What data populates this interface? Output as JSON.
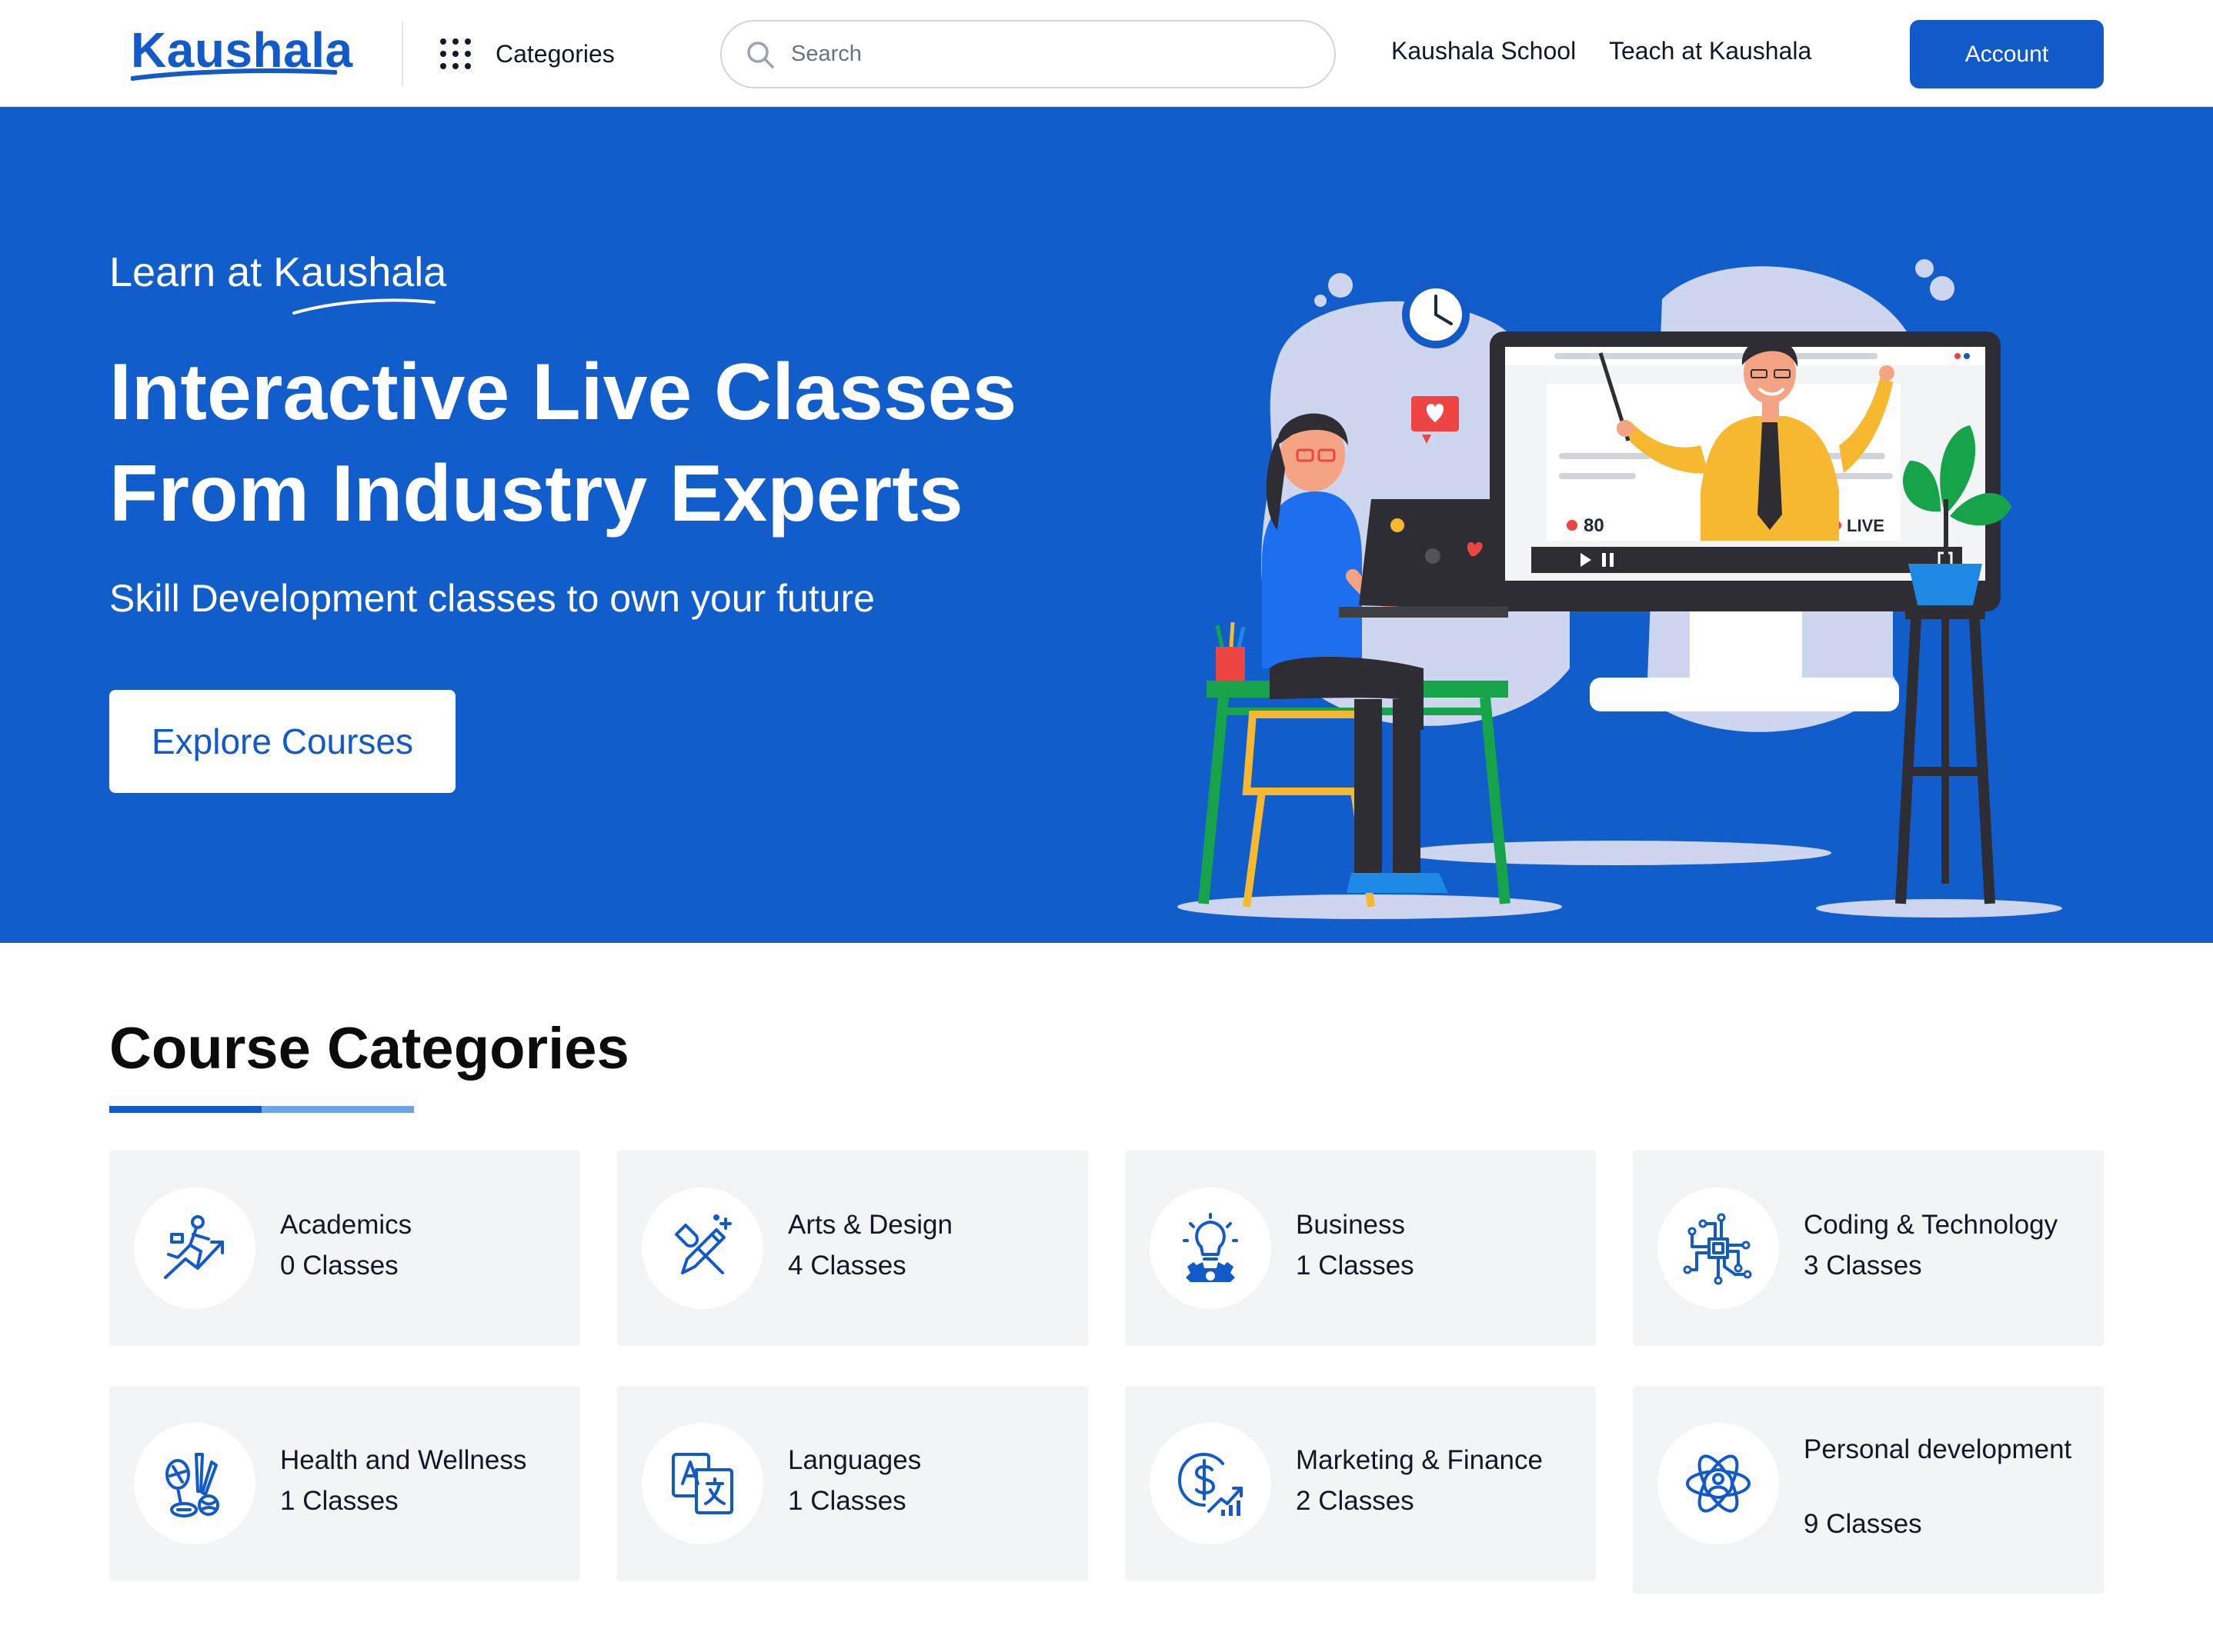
{
  "brand": {
    "name": "Kaushala",
    "color": "#1259c9"
  },
  "header": {
    "categories_label": "Categories",
    "search_placeholder": "Search",
    "nav": {
      "school": "Kaushala School",
      "teach": "Teach at Kaushala"
    },
    "account_label": "Account"
  },
  "hero": {
    "background": "#125dcc",
    "kicker": "Learn at Kaushala",
    "title_line1": "Interactive Live Classes",
    "title_line2": "From Industry Experts",
    "subtitle": "Skill Development classes to own your future",
    "cta_label": "Explore Courses",
    "illustration": {
      "viewer_count": "80",
      "live_badge": "LIVE"
    }
  },
  "categories_section": {
    "title": "Course Categories",
    "items": [
      {
        "name": "Academics",
        "count": "0 Classes",
        "icon": "academics-icon"
      },
      {
        "name": "Arts & Design",
        "count": "4 Classes",
        "icon": "pencil-brush-icon"
      },
      {
        "name": "Business",
        "count": "1 Classes",
        "icon": "lightbulb-gear-icon"
      },
      {
        "name": "Coding & Technology",
        "count": "3 Classes",
        "icon": "circuit-chip-icon"
      },
      {
        "name": "Health and Wellness",
        "count": "1 Classes",
        "icon": "sports-equipment-icon"
      },
      {
        "name": "Languages",
        "count": "1 Classes",
        "icon": "translate-icon"
      },
      {
        "name": "Marketing & Finance",
        "count": "2 Classes",
        "icon": "dollar-growth-icon"
      },
      {
        "name": "Personal development",
        "count": "9 Classes",
        "icon": "atom-person-icon"
      }
    ]
  }
}
